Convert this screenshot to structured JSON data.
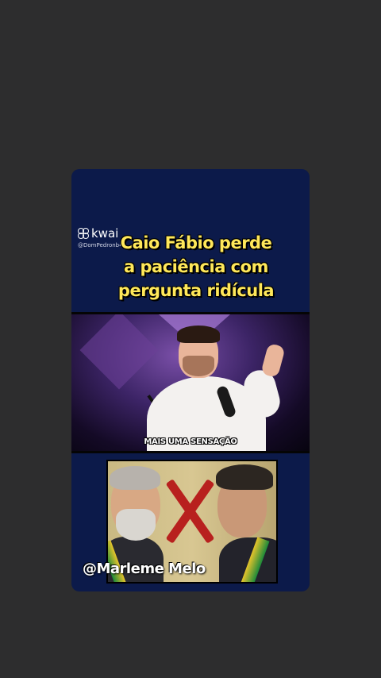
{
  "post": {
    "app_logo": "kwai",
    "handle": "@DomPedronb45...",
    "headline": [
      "Caio Fábio perde",
      "a paciência com",
      "pergunta ridícula"
    ],
    "video_subtitle": "MAIS UMA SENSAÇÃO",
    "watermark": "@Marleme Melo"
  },
  "colors": {
    "background": "#2d2d2e",
    "card": "#0c1a4a",
    "headline": "#ffe85a",
    "x_mark": "#b8201e"
  }
}
